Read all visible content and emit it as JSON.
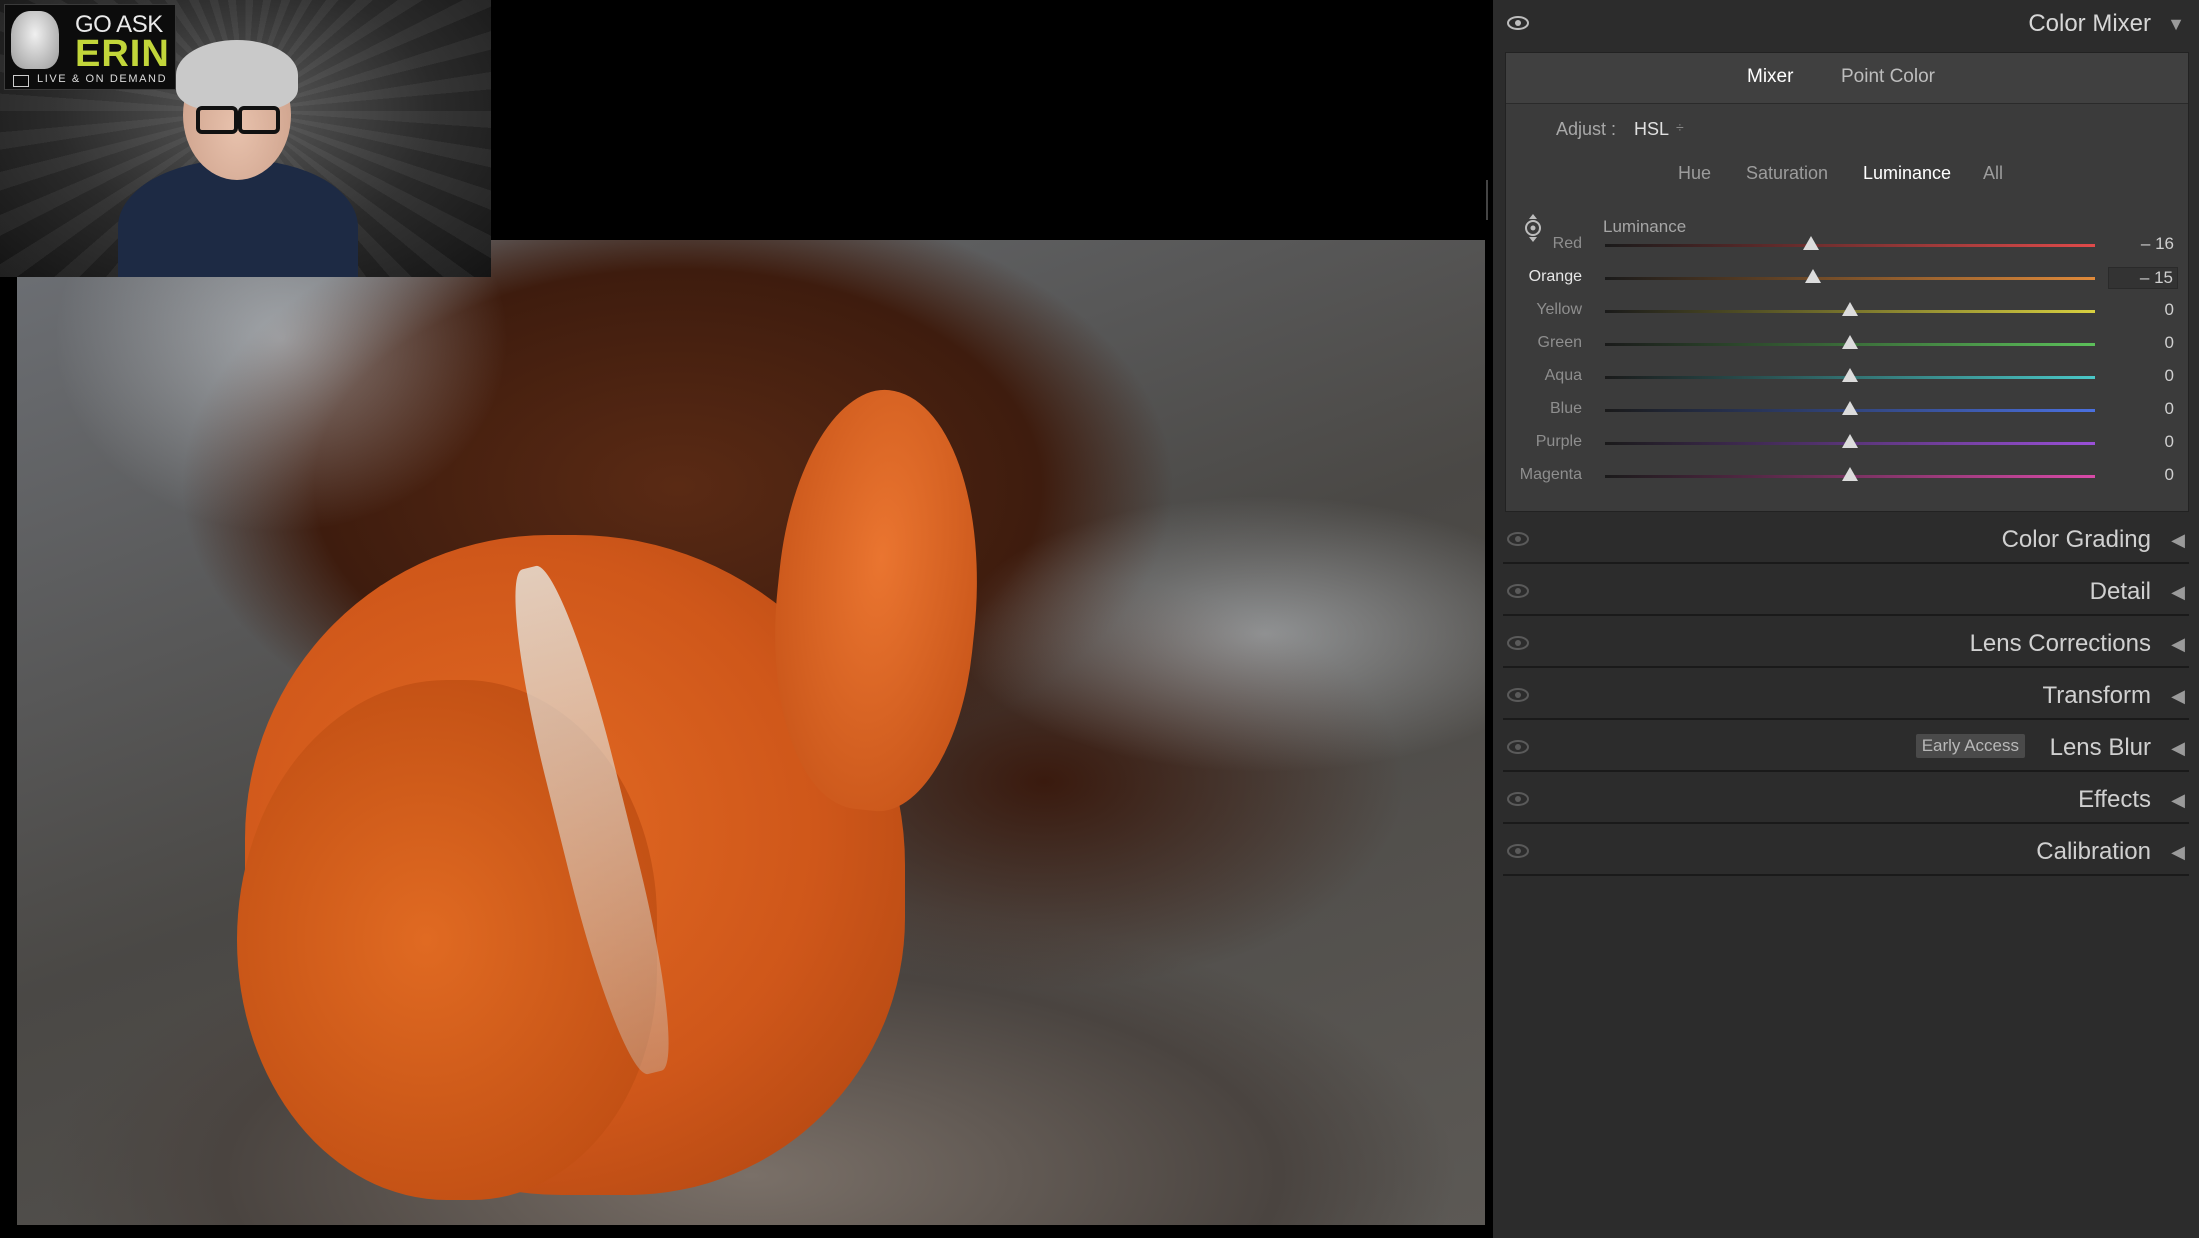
{
  "webcam": {
    "logo_line1": "GO ASK",
    "logo_line2": "ERIN",
    "logo_line3": "LIVE & ON DEMAND"
  },
  "panel": {
    "color_mixer": {
      "title": "Color Mixer",
      "tabs": [
        {
          "label": "Mixer",
          "active": true
        },
        {
          "label": "Point Color",
          "active": false
        }
      ],
      "adjust_label": "Adjust :",
      "adjust_value": "HSL",
      "subtabs": [
        {
          "label": "Hue",
          "active": false
        },
        {
          "label": "Saturation",
          "active": false
        },
        {
          "label": "Luminance",
          "active": true
        },
        {
          "label": "All",
          "active": false
        }
      ],
      "group_heading": "Luminance",
      "sliders": [
        {
          "label": "Red",
          "value": -16,
          "display": "– 16",
          "color": "#e04a4a",
          "highlight": false
        },
        {
          "label": "Orange",
          "value": -15,
          "display": "– 15",
          "color": "#e08a3a",
          "highlight": true
        },
        {
          "label": "Yellow",
          "value": 0,
          "display": "0",
          "color": "#d8d040",
          "highlight": false
        },
        {
          "label": "Green",
          "value": 0,
          "display": "0",
          "color": "#5cc05a",
          "highlight": false
        },
        {
          "label": "Aqua",
          "value": 0,
          "display": "0",
          "color": "#4ac8c8",
          "highlight": false
        },
        {
          "label": "Blue",
          "value": 0,
          "display": "0",
          "color": "#4a70e0",
          "highlight": false
        },
        {
          "label": "Purple",
          "value": 0,
          "display": "0",
          "color": "#9a50d8",
          "highlight": false
        },
        {
          "label": "Magenta",
          "value": 0,
          "display": "0",
          "color": "#d84aa8",
          "highlight": false
        }
      ],
      "slider_range": [
        -100,
        100
      ]
    },
    "sections": [
      {
        "title": "Color Grading",
        "badge": ""
      },
      {
        "title": "Detail",
        "badge": ""
      },
      {
        "title": "Lens Corrections",
        "badge": ""
      },
      {
        "title": "Transform",
        "badge": ""
      },
      {
        "title": "Lens Blur",
        "badge": "Early Access"
      },
      {
        "title": "Effects",
        "badge": ""
      },
      {
        "title": "Calibration",
        "badge": ""
      }
    ]
  }
}
